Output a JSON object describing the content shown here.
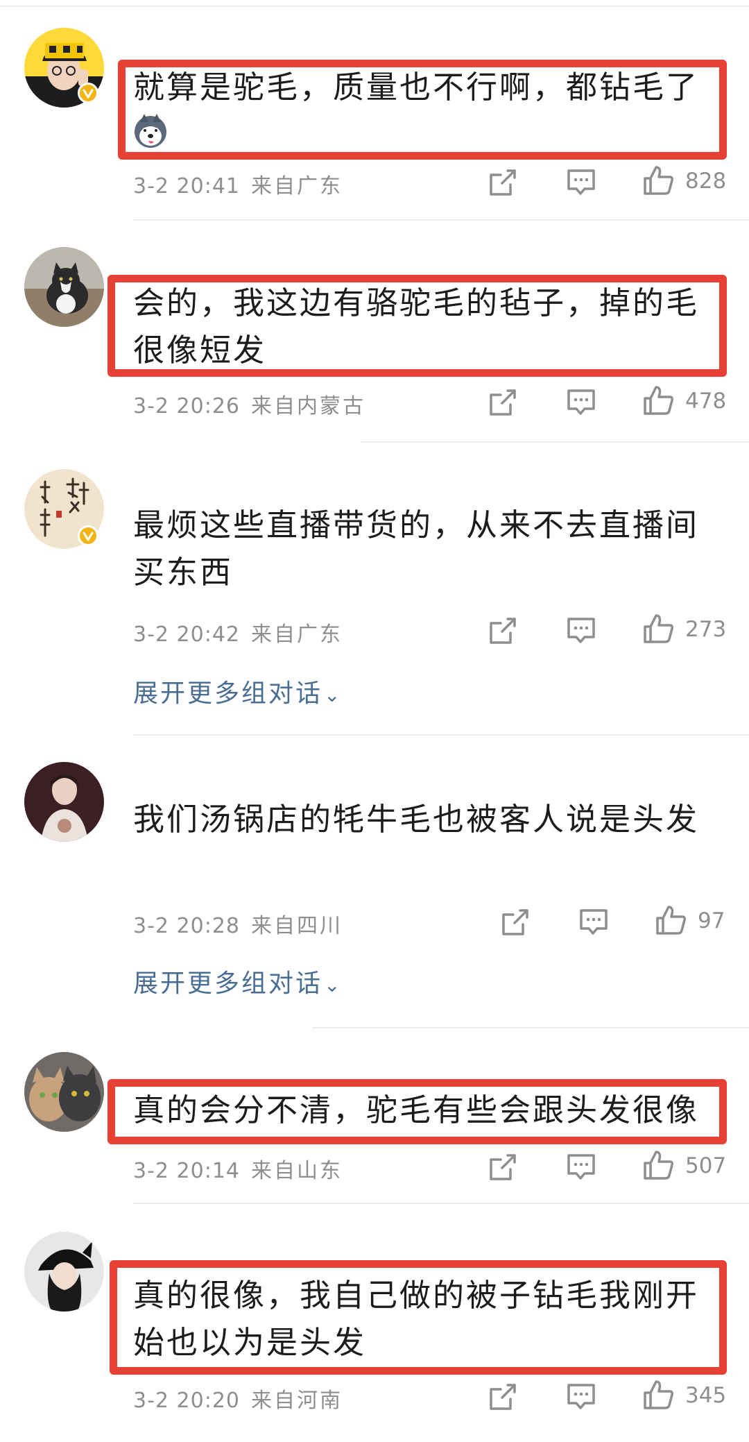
{
  "comments": [
    {
      "text": "就算是驼毛，质量也不行啊，都钻毛了",
      "time": "3-2 20:41",
      "location": "来自广东",
      "likes": "828",
      "verified": true,
      "highlighted": true,
      "has_emoji": true,
      "avatar": "avatar-man-yellow-cap"
    },
    {
      "text": "会的，我这边有骆驼毛的毡子，掉的毛很像短发",
      "time": "3-2 20:26",
      "location": "来自内蒙古",
      "likes": "478",
      "verified": false,
      "highlighted": true,
      "avatar": "avatar-cat"
    },
    {
      "text": "最烦这些直播带货的，从来不去直播间买东西",
      "time": "3-2 20:42",
      "location": "来自广东",
      "likes": "273",
      "verified": true,
      "highlighted": false,
      "expand": "展开更多组对话",
      "avatar": "avatar-calligraphy"
    },
    {
      "text": "我们汤锅店的牦牛毛也被客人说是头发",
      "time": "3-2 20:28",
      "location": "来自四川",
      "likes": "97",
      "verified": false,
      "highlighted": false,
      "expand": "展开更多组对话",
      "avatar": "avatar-person-dark"
    },
    {
      "text": "真的会分不清，驼毛有些会跟头发很像",
      "time": "3-2 20:14",
      "location": "来自山东",
      "likes": "507",
      "verified": false,
      "highlighted": true,
      "avatar": "avatar-two-cats"
    },
    {
      "text": "真的很像，我自己做的被子钻毛我刚开始也以为是头发",
      "time": "3-2 20:20",
      "location": "来自河南",
      "likes": "345",
      "verified": false,
      "highlighted": true,
      "avatar": "avatar-girl-black-hat"
    }
  ],
  "colors": {
    "highlight_border": "#e84035",
    "meta_text": "#8e8e8e",
    "link_text": "#4a6d93",
    "verified_badge": "#f3b516"
  },
  "icons": {
    "repost": "share-square-icon",
    "comment": "comment-bubble-icon",
    "like": "thumbs-up-icon",
    "expand": "chevron-down-icon"
  }
}
